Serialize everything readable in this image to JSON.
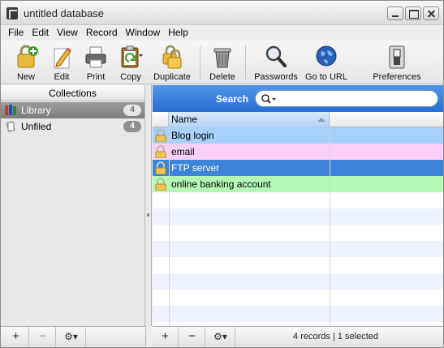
{
  "window": {
    "title": "untitled database"
  },
  "menu": [
    "File",
    "Edit",
    "View",
    "Record",
    "Window",
    "Help"
  ],
  "toolbar": {
    "new": "New",
    "edit": "Edit",
    "print": "Print",
    "copy": "Copy",
    "duplicate": "Duplicate",
    "delete": "Delete",
    "passwords": "Passwords",
    "go_to_url": "Go to URL",
    "preferences": "Preferences"
  },
  "collections": {
    "header": "Collections",
    "items": [
      {
        "label": "Library",
        "count": "4",
        "selected": true
      },
      {
        "label": "Unfiled",
        "count": "4",
        "selected": false
      }
    ]
  },
  "search": {
    "label": "Search",
    "value": ""
  },
  "table": {
    "column_name": "Name",
    "rows": [
      {
        "name": "Blog login",
        "color": "#a7d1fb"
      },
      {
        "name": "email",
        "color": "#fbd0f8"
      },
      {
        "name": "FTP server",
        "color": "#3d84d8"
      },
      {
        "name": "online banking account",
        "color": "#b3fbb4"
      }
    ]
  },
  "bottom": {
    "add": "+",
    "remove": "−",
    "status": "4 records | 1 selected"
  },
  "colors": {
    "accent": "#2a6ed3",
    "selected_collection": "#8a8a8a"
  }
}
